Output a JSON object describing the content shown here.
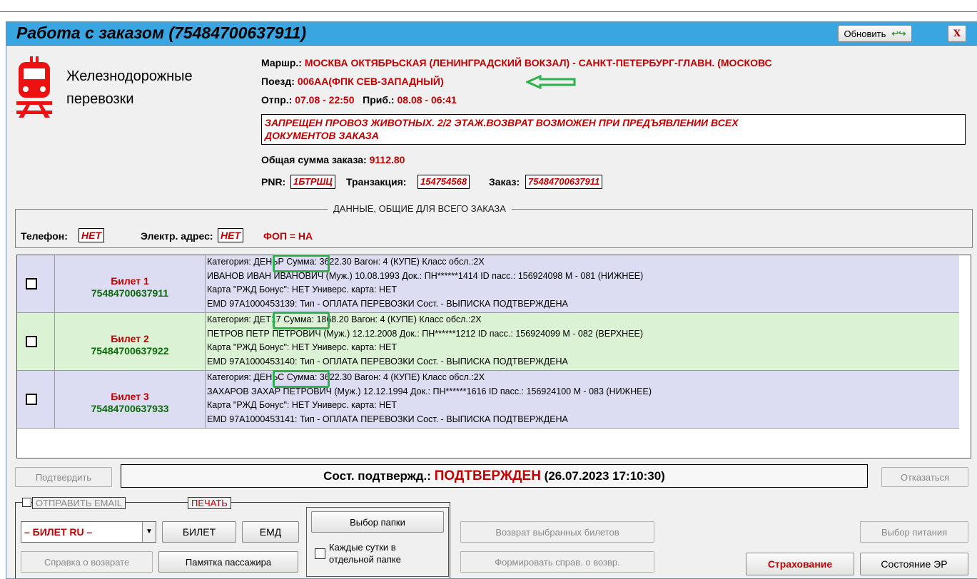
{
  "window": {
    "title": "Работа с заказом (75484700637911)",
    "refresh_label": "Обновить",
    "close_label": "X"
  },
  "brand": {
    "line1": "Железнодорожные",
    "line2": "перевозки"
  },
  "order": {
    "route_label": "Маршр.:",
    "route_value": "МОСКВА ОКТЯБРЬСКАЯ (ЛЕНИНГРАДСКИЙ ВОКЗАЛ) - САНКТ-ПЕТЕРБУРГ-ГЛАВН. (МОСКОВС",
    "train_label": "Поезд:",
    "train_value": "006АА(ФПК СЕВ-ЗАПАДНЫЙ)",
    "dep_label": "Отпр.:",
    "dep_value": "07.08 - 22:50",
    "arr_label": "Приб.:",
    "arr_value": "08.08 - 06:41",
    "note_line1": "ЗАПРЕЩЕН ПРОВОЗ ЖИВОТНЫХ. 2/2 ЭТАЖ.ВОЗВРАТ ВОЗМОЖЕН ПРИ ПРЕДЪЯВЛЕНИИ ВСЕХ",
    "note_line2": "ДОКУМЕНТОВ ЗАКАЗА",
    "total_label": "Общая сумма заказа:",
    "total_value": "9112.80",
    "pnr_label": "PNR:",
    "pnr_value": "1БТРШЦ",
    "trans_label": "Транзакция:",
    "trans_value": "154754568",
    "order_label": "Заказ:",
    "order_value": "75484700637911"
  },
  "common": {
    "legend": "ДАННЫЕ, ОБЩИЕ ДЛЯ ВСЕГО ЗАКАЗА",
    "phone_label": "Телефон:",
    "phone_value": "НЕТ",
    "email_label": "Электр. адрес:",
    "email_value": "НЕТ",
    "fop": "ФОП = НА"
  },
  "tickets": [
    {
      "name": "Билет 1",
      "number": "75484700637911",
      "bg": "#dcdcf2",
      "cat_label": "Категория:",
      "category": "ДЕНЬР",
      "line1_rest": "Сумма: 3622.30   Вагон: 4 (КУПЕ)  Класс обсл.:2Х",
      "line2": "ИВАНОВ ИВАН ИВАНОВИЧ (Муж.) 10.08.1993  Док.: ПН******1414  ID пасс.: 156924098  М - 081 (НИЖНЕЕ)",
      "line3": "Карта \"РЖД Бонус\": НЕТ   Универс. карта: НЕТ",
      "line4": "EMD 97A1000453139: Тип - ОПЛАТА ПЕРЕВОЗКИ Сост. - ВЫПИСКА ПОДТВЕРЖДЕНА"
    },
    {
      "name": "Билет 2",
      "number": "75484700637922",
      "bg": "#dcf2d4",
      "cat_label": "Категория:",
      "category": "ДЕТ17",
      "line1_rest": "Сумма: 1868.20   Вагон: 4 (КУПЕ)  Класс обсл.:2Х",
      "line2": "ПЕТРОВ ПЕТР ПЕТРОВИЧ (Муж.) 12.12.2008   Док.: ПН******1212   ID пасс.: 156924099  М - 082 (ВЕРХНЕЕ)",
      "line3": "Карта \"РЖД Бонус\": НЕТ   Универс. карта: НЕТ",
      "line4": "EMD 97A1000453140: Тип - ОПЛАТА ПЕРЕВОЗКИ Сост. - ВЫПИСКА ПОДТВЕРЖДЕНА"
    },
    {
      "name": "Билет 3",
      "number": "75484700637933",
      "bg": "#dcdcf2",
      "cat_label": "Категория:",
      "category": "ДЕНЬС",
      "line1_rest": "Сумма: 3622.30   Вагон: 4 (КУПЕ)  Класс обсл.:2Х",
      "line2": "ЗАХАРОВ ЗАХАР ПЕТРОВИЧ (Муж.) 12.12.1994   Док.: ПН******1616   ID пасс.: 156924100  М - 083 (НИЖНЕЕ)",
      "line3": "Карта \"РЖД Бонус\": НЕТ   Универс. карта: НЕТ",
      "line4": "EMD 97A1000453141: Тип - ОПЛАТА ПЕРЕВОЗКИ Сост. - ВЫПИСКА ПОДТВЕРЖДЕНА"
    }
  ],
  "status": {
    "confirm_button": "Подтвердить",
    "label": "Сост. подтвержд.:",
    "value": "ПОДТВЕРЖДЕН",
    "datetime": "(26.07.2023 17:10:30)",
    "refuse_button": "Отказаться"
  },
  "bottom": {
    "send_email_label": "ОТПРАВИТЬ EMAIL",
    "print_label": "ПЕЧАТЬ",
    "combo_value": "– БИЛЕТ RU –",
    "ticket_button": "БИЛЕТ",
    "emd_button": "ЕМД",
    "refund_info_button": "Справка о возврате",
    "memo_button": "Памятка пассажира",
    "folder_button": "Выбор папки",
    "daily_folder_line1": "Каждые сутки в",
    "daily_folder_line2": "отдельной папке",
    "return_selected_button": "Возврат выбранных билетов",
    "form_refund_button": "Формировать справ. о возвр.",
    "insurance_button": "Страхование",
    "meal_button": "Выбор питания",
    "er_state_button": "Состояние ЭР"
  },
  "colors": {
    "titlebar": "#3aa6e1",
    "accent_red": "#c00000",
    "accent_green": "#0b6b0b",
    "highlight_green": "#2bb24c"
  }
}
